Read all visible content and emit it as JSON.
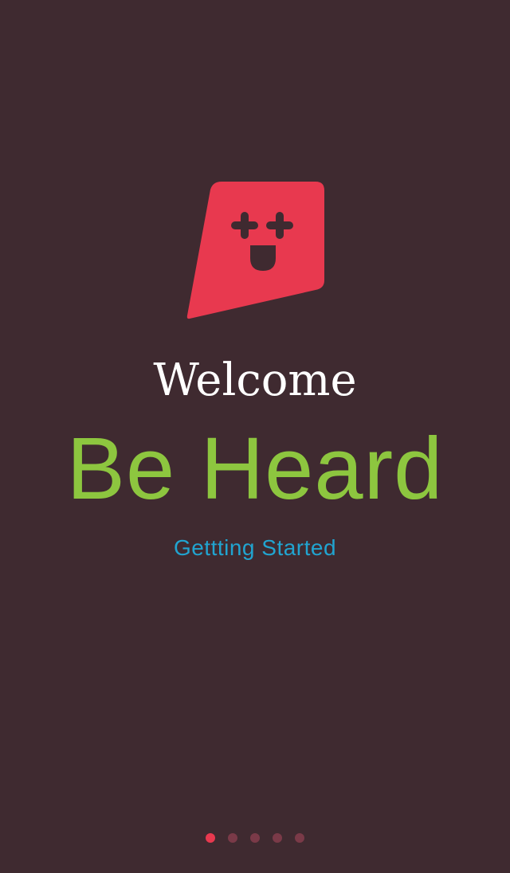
{
  "welcome_title": "Welcome",
  "tagline": "Be Heard",
  "cta_label": "Gettting Started",
  "pager": {
    "total": 5,
    "active_index": 0
  },
  "colors": {
    "background": "#3f2a30",
    "logo": "#e8394f",
    "tagline": "#8dc63f",
    "cta": "#21a4d0",
    "dot_active": "#e8394f",
    "dot_inactive": "#7a3a48"
  },
  "icons": {
    "logo": "speech-bubble-smiley-icon"
  }
}
